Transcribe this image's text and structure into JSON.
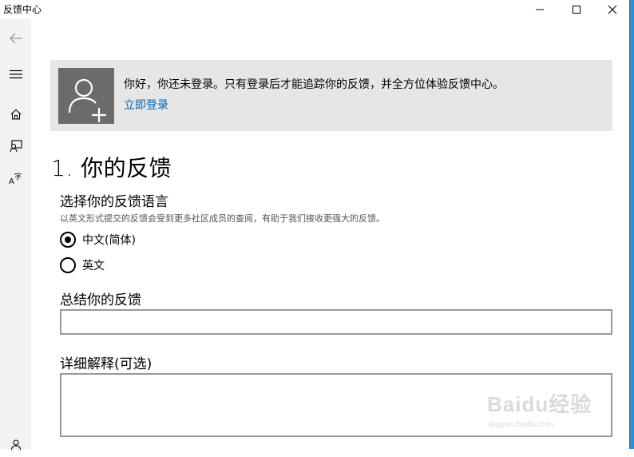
{
  "window": {
    "title": "反馈中心",
    "controls": [
      "minimize-icon",
      "maximize-icon",
      "close-icon"
    ]
  },
  "sidebar": {
    "items": [
      "back-arrow-icon",
      "hamburger-menu-icon",
      "home-icon",
      "feedback-icon",
      "language-icon",
      "account-icon"
    ]
  },
  "banner": {
    "message": "你好，你还未登录。只有登录后才能追踪你的反馈，并全方位体验反馈中心。",
    "link": "立即登录",
    "icon": "add-user-icon"
  },
  "form": {
    "section_title": "1. 你的反馈",
    "language_label": "选择你的反馈语言",
    "language_hint": "以英文形式提交的反馈会受到更多社区成员的查阅，有助于我们接收更强大的反馈。",
    "language_options": [
      {
        "label": "中文(简体)",
        "selected": true
      },
      {
        "label": "英文",
        "selected": false
      }
    ],
    "summary_label": "总结你的反馈",
    "summary_value": "",
    "details_label": "详细解释(可选)",
    "details_value": ""
  },
  "watermark": {
    "text": "Baidu经验",
    "url": "jingyan.baidu.com"
  },
  "colors": {
    "accent_link": "#0063b1",
    "banner_bg": "#e6e6e6",
    "avatar_bg": "#6b6b6b",
    "sidebar_bg": "#f2f2f2"
  }
}
